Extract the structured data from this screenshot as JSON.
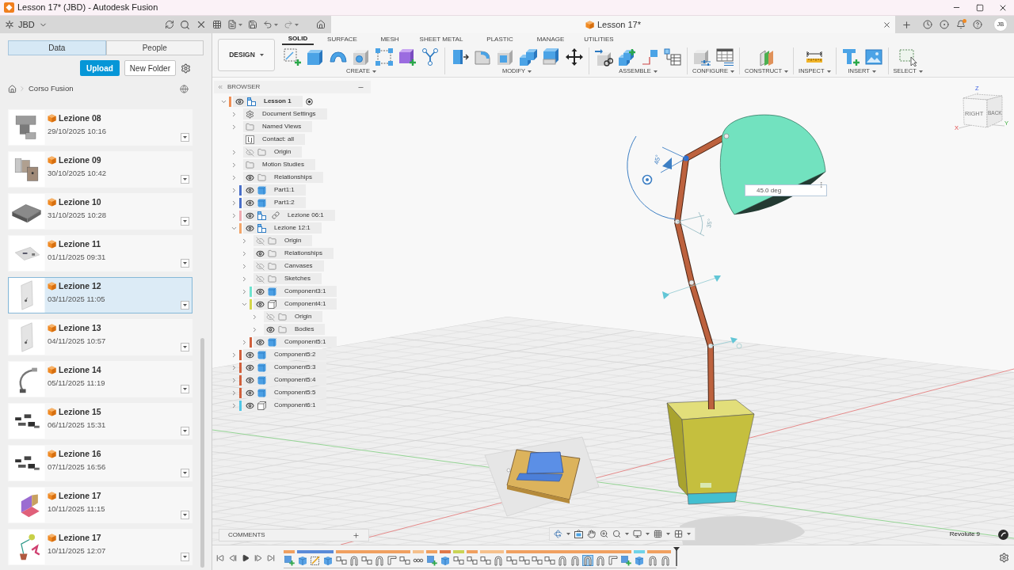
{
  "window": {
    "title": "Lesson 17* (JBD) - Autodesk Fusion"
  },
  "app_bar": {
    "team": "JBD",
    "document_tab": "Lesson 17*",
    "avatar": "JB"
  },
  "data_panel": {
    "tabs": [
      {
        "label": "Data",
        "selected": true
      },
      {
        "label": "People",
        "selected": false
      }
    ],
    "upload": "Upload",
    "new_folder": "New Folder",
    "breadcrumb": "Corso Fusion",
    "files": [
      {
        "name": "Lezione 08",
        "date": "29/10/2025 10:16",
        "selected": false,
        "kind": "blocks"
      },
      {
        "name": "Lezione 09",
        "date": "30/10/2025 10:42",
        "selected": false,
        "kind": "panels"
      },
      {
        "name": "Lezione 10",
        "date": "31/10/2025 10:28",
        "selected": false,
        "kind": "room"
      },
      {
        "name": "Lezione 11",
        "date": "01/11/2025 09:31",
        "selected": false,
        "kind": "plate"
      },
      {
        "name": "Lezione 12",
        "date": "03/11/2025 11:05",
        "selected": true,
        "kind": "sheet"
      },
      {
        "name": "Lezione 13",
        "date": "04/11/2025 10:57",
        "selected": false,
        "kind": "sheet"
      },
      {
        "name": "Lezione 14",
        "date": "05/11/2025 11:19",
        "selected": false,
        "kind": "arm"
      },
      {
        "name": "Lezione 15",
        "date": "06/11/2025 15:31",
        "selected": false,
        "kind": "parts"
      },
      {
        "name": "Lezione 16",
        "date": "07/11/2025 16:56",
        "selected": false,
        "kind": "parts"
      },
      {
        "name": "Lezione 17",
        "date": "10/11/2025 11:15",
        "selected": false,
        "kind": "folded"
      },
      {
        "name": "Lezione 17",
        "date": "10/11/2025 12:07",
        "selected": false,
        "kind": "lamp"
      }
    ]
  },
  "toolbar": {
    "workspace": "DESIGN",
    "tabs": [
      {
        "label": "SOLID",
        "selected": true
      },
      {
        "label": "SURFACE",
        "selected": false
      },
      {
        "label": "MESH",
        "selected": false
      },
      {
        "label": "SHEET METAL",
        "selected": false
      },
      {
        "label": "PLASTIC",
        "selected": false
      },
      {
        "label": "MANAGE",
        "selected": false
      },
      {
        "label": "UTILITIES",
        "selected": false
      }
    ],
    "groups": [
      {
        "label": "CREATE",
        "kind": "create"
      },
      {
        "label": "MODIFY",
        "kind": "modify"
      },
      {
        "label": "ASSEMBLE",
        "kind": "assemble"
      },
      {
        "label": "CONFIGURE",
        "kind": "configure"
      },
      {
        "label": "CONSTRUCT",
        "kind": "construct"
      },
      {
        "label": "INSPECT",
        "kind": "inspect"
      },
      {
        "label": "INSERT",
        "kind": "insert"
      },
      {
        "label": "SELECT",
        "kind": "select"
      }
    ]
  },
  "browser": {
    "title": "BROWSER",
    "tree": [
      {
        "label": "Lesson 1",
        "kind": "assembly",
        "visible": true,
        "expanded": true,
        "color": "#ef8f55",
        "children": [
          {
            "label": "Document Settings",
            "kind": "settings",
            "expanded": false
          },
          {
            "label": "Named Views",
            "kind": "folder",
            "expanded": false
          },
          {
            "label": "Contact: all",
            "kind": "contact"
          },
          {
            "label": "Origin",
            "kind": "folder",
            "visible": false,
            "expanded": false
          },
          {
            "label": "Motion Studies",
            "kind": "folder",
            "expanded": false
          },
          {
            "label": "Relationships",
            "kind": "folder",
            "visible": true,
            "expanded": false
          },
          {
            "label": "Part1:1",
            "kind": "body",
            "visible": true,
            "expanded": false,
            "color": "#4a6fc9"
          },
          {
            "label": "Part1:2",
            "kind": "body",
            "visible": true,
            "expanded": false,
            "color": "#4a6fc9"
          },
          {
            "label": "Lezione 06:1",
            "kind": "linked",
            "visible": true,
            "expanded": false,
            "color": "#eeaab0"
          },
          {
            "label": "Lezione 12:1",
            "kind": "assembly",
            "visible": true,
            "expanded": true,
            "color": "#f2a66a",
            "children": [
              {
                "label": "Origin",
                "kind": "folder",
                "visible": false,
                "expanded": false
              },
              {
                "label": "Relationships",
                "kind": "folder",
                "visible": true,
                "expanded": false
              },
              {
                "label": "Canvases",
                "kind": "folder",
                "visible": false,
                "expanded": false
              },
              {
                "label": "Sketches",
                "kind": "folder",
                "visible": false,
                "expanded": false
              },
              {
                "label": "Component3:1",
                "kind": "body",
                "visible": true,
                "expanded": false,
                "color": "#6fe3cf"
              },
              {
                "label": "Component4:1",
                "kind": "component",
                "visible": true,
                "expanded": true,
                "color": "#d4d64a",
                "children": [
                  {
                    "label": "Origin",
                    "kind": "folder",
                    "visible": false,
                    "expanded": false
                  },
                  {
                    "label": "Bodies",
                    "kind": "folder",
                    "visible": true,
                    "expanded": false
                  }
                ]
              },
              {
                "label": "Component5:1",
                "kind": "body",
                "visible": true,
                "expanded": false,
                "color": "#d0603c"
              }
            ]
          },
          {
            "label": "Component5:2",
            "kind": "body",
            "visible": true,
            "expanded": false,
            "color": "#d0603c"
          },
          {
            "label": "Component5:3",
            "kind": "body",
            "visible": true,
            "expanded": false,
            "color": "#d0603c"
          },
          {
            "label": "Component5:4",
            "kind": "body",
            "visible": true,
            "expanded": false,
            "color": "#d0603c"
          },
          {
            "label": "Component5:5",
            "kind": "body",
            "visible": true,
            "expanded": false,
            "color": "#d0603c"
          },
          {
            "label": "Component6:1",
            "kind": "component",
            "visible": true,
            "expanded": false,
            "color": "#4fc6e6"
          }
        ]
      }
    ]
  },
  "viewport": {
    "angle_input": "45.0 deg",
    "angle_labels": [
      "45°",
      "35°"
    ],
    "view_cube": {
      "faces": [
        "RIGHT",
        "BACK"
      ],
      "axes": [
        "Z",
        "X",
        "Y"
      ]
    },
    "status": "Revolute 9"
  },
  "comments": {
    "title": "COMMENTS"
  },
  "timeline": {
    "groups": [
      {
        "color": "#f0a060",
        "features": [
          {
            "kind": "component",
            "selected": false
          }
        ]
      },
      {
        "color": "#5a8ad8",
        "features": [
          {
            "kind": "body",
            "selected": false
          },
          {
            "kind": "sketch",
            "selected": false
          },
          {
            "kind": "body",
            "selected": false
          }
        ]
      },
      {
        "color": "#f0a060",
        "features": [
          {
            "kind": "joint",
            "selected": false
          },
          {
            "kind": "revolute",
            "selected": false
          },
          {
            "kind": "joint",
            "selected": false
          },
          {
            "kind": "revolute",
            "selected": false
          },
          {
            "kind": "slider",
            "selected": false
          },
          {
            "kind": "joint",
            "selected": false
          }
        ]
      },
      {
        "color": "#f5c08c",
        "features": [
          {
            "kind": "pattern",
            "selected": false
          }
        ]
      },
      {
        "color": "#f0a060",
        "features": [
          {
            "kind": "component",
            "selected": false
          }
        ]
      },
      {
        "color": "#e0784a",
        "features": [
          {
            "kind": "body",
            "selected": false
          }
        ]
      },
      {
        "color": "#c9d455",
        "features": [
          {
            "kind": "joint",
            "selected": false
          }
        ]
      },
      {
        "color": "#f0a060",
        "features": [
          {
            "kind": "joint",
            "selected": false
          }
        ]
      },
      {
        "color": "#f5c08c",
        "features": [
          {
            "kind": "joint",
            "selected": false
          },
          {
            "kind": "revolute",
            "selected": false
          }
        ]
      },
      {
        "color": "#f0a060",
        "features": [
          {
            "kind": "joint",
            "selected": false
          },
          {
            "kind": "joint",
            "selected": false
          },
          {
            "kind": "joint",
            "selected": false
          },
          {
            "kind": "joint",
            "selected": false
          },
          {
            "kind": "revolute",
            "selected": false
          },
          {
            "kind": "revolute",
            "selected": false
          },
          {
            "kind": "revolute",
            "selected": true
          },
          {
            "kind": "revolute",
            "selected": false
          },
          {
            "kind": "slider",
            "selected": false
          },
          {
            "kind": "component",
            "selected": false
          }
        ]
      },
      {
        "color": "#6fd3e8",
        "features": [
          {
            "kind": "body",
            "selected": false
          }
        ]
      },
      {
        "color": "#f0a060",
        "features": [
          {
            "kind": "revolute",
            "selected": false
          },
          {
            "kind": "revolute",
            "selected": false
          }
        ]
      }
    ]
  }
}
